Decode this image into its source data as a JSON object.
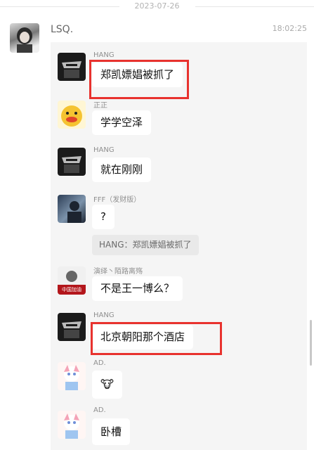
{
  "date_separator": "2023-07-26",
  "sender": {
    "name": "LSQ.",
    "time": "18:02:25"
  },
  "messages": [
    {
      "name": "HANG",
      "text": "郑凯嫖娼被抓了"
    },
    {
      "name": "正正",
      "text": "学学空泽"
    },
    {
      "name": "HANG",
      "text": "就在刚刚"
    },
    {
      "name": "FFF（发财版）",
      "text": "?",
      "quote": "HANG：郑凯嫖娼被抓了"
    },
    {
      "name": "演绎丶陌路离殇",
      "text": "不是王一博么？",
      "avatar_text": "中国加油"
    },
    {
      "name": "HANG",
      "text": "北京朝阳那个酒店"
    },
    {
      "name": "AD.",
      "text": "🐮"
    },
    {
      "name": "AD.",
      "text": "卧槽"
    }
  ],
  "colors": {
    "highlight": "#e8322e",
    "card_bg": "#f5f5f5",
    "bubble_bg": "#ffffff"
  },
  "icons": [
    "hang-avatar-icon",
    "duck-avatar-icon",
    "fff-avatar-icon",
    "yanyi-avatar-icon",
    "ad-avatar-icon",
    "cow-emoji-icon"
  ]
}
